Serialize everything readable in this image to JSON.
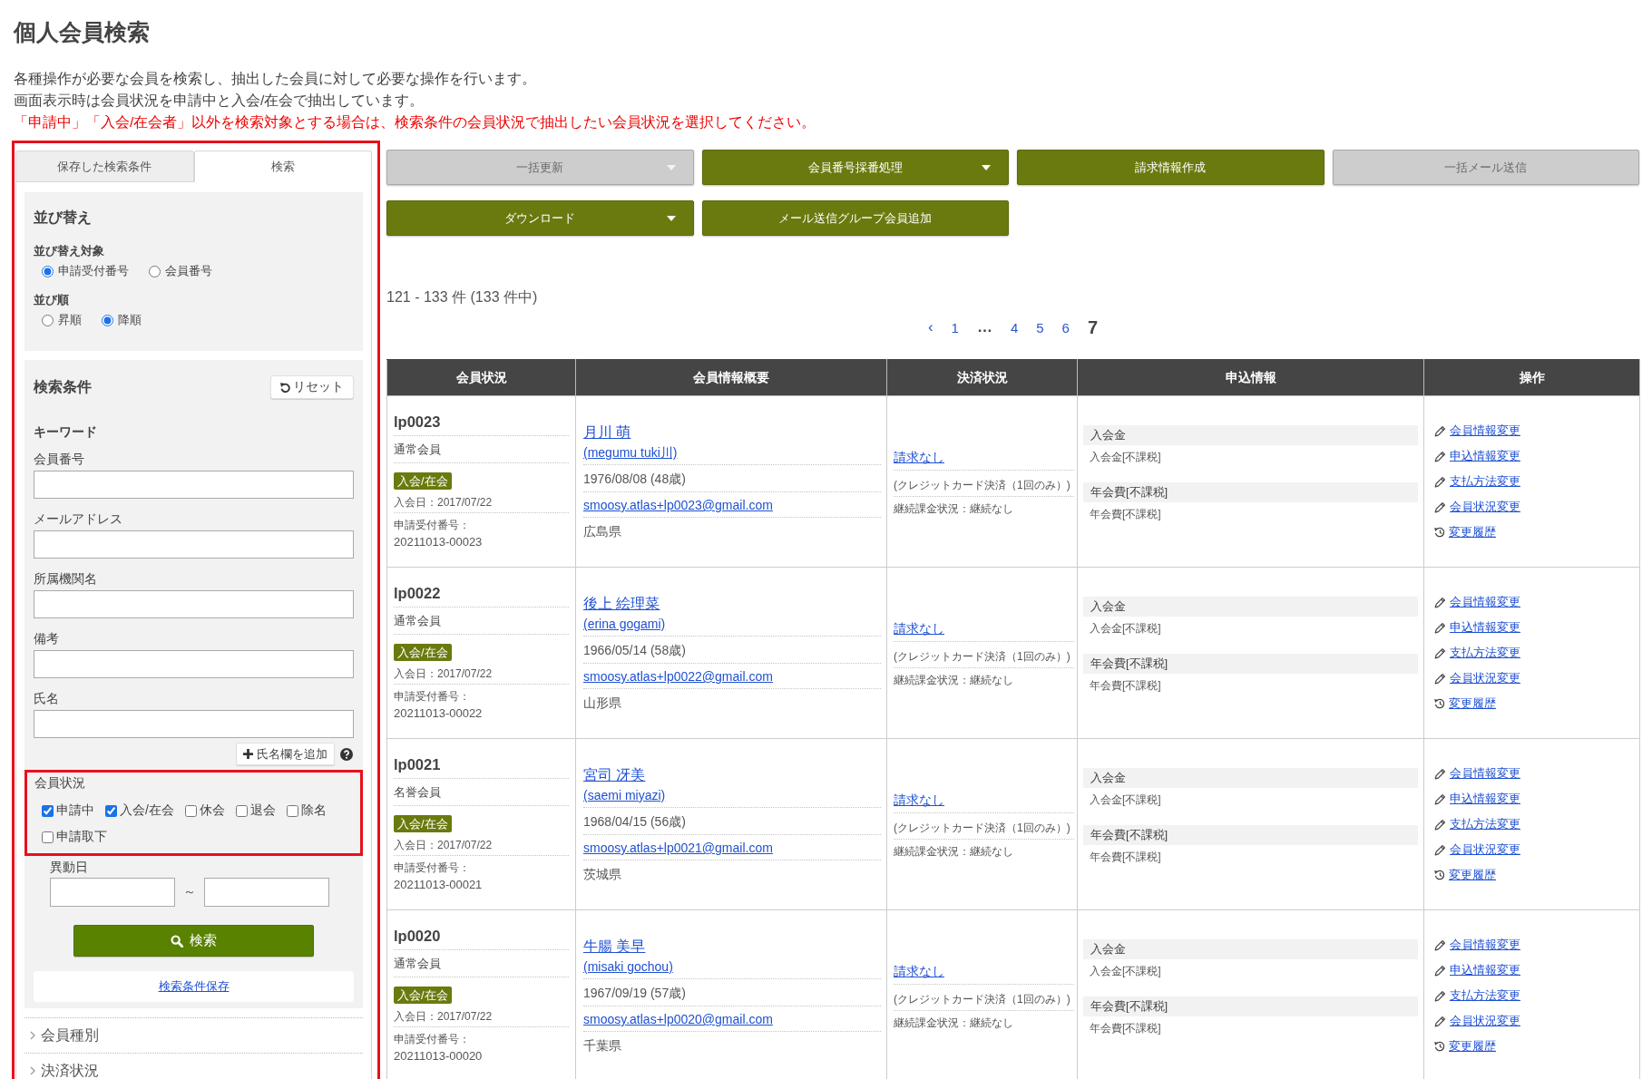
{
  "page": {
    "title": "個人会員検索",
    "description": [
      "各種操作が必要な会員を検索し、抽出した会員に対して必要な操作を行います。",
      "画面表示時は会員状況を申請中と入会/在会で抽出しています。"
    ],
    "notice": "「申請中」「入会/在会者」以外を検索対象とする場合は、検索条件の会員状況で抽出したい会員状況を選択してください。"
  },
  "sidebar": {
    "tabs": [
      {
        "label": "保存した検索条件",
        "selected": false
      },
      {
        "label": "検索",
        "selected": true
      }
    ],
    "sort": {
      "title": "並び替え",
      "target_label": "並び替え対象",
      "target_options": [
        {
          "label": "申請受付番号",
          "selected": true
        },
        {
          "label": "会員番号",
          "selected": false
        }
      ],
      "order_label": "並び順",
      "order_options": [
        {
          "label": "昇順",
          "selected": false
        },
        {
          "label": "降順",
          "selected": true
        }
      ]
    },
    "search": {
      "title": "検索条件",
      "reset_button": "リセット",
      "keyword_label": "キーワード",
      "fields": [
        {
          "label": "会員番号"
        },
        {
          "label": "メールアドレス"
        },
        {
          "label": "所属機関名"
        },
        {
          "label": "備考"
        },
        {
          "label": "氏名"
        }
      ],
      "add_name_button": "氏名欄を追加",
      "status": {
        "label": "会員状況",
        "options": [
          {
            "label": "申請中",
            "checked": true
          },
          {
            "label": "入会/在会",
            "checked": true
          },
          {
            "label": "休会",
            "checked": false
          },
          {
            "label": "退会",
            "checked": false
          },
          {
            "label": "除名",
            "checked": false
          },
          {
            "label": "申請取下",
            "checked": false
          }
        ]
      },
      "date": {
        "label": "異動日",
        "separator": "～"
      },
      "search_button": "検索",
      "save_link": "検索条件保存"
    },
    "sections": [
      {
        "label": "会員種別",
        "expanded": false
      },
      {
        "label": "決済状況",
        "expanded": false
      }
    ]
  },
  "actions": [
    {
      "label": "一括更新",
      "disabled": true,
      "dropdown": true
    },
    {
      "label": "会員番号採番処理",
      "disabled": false,
      "dropdown": true
    },
    {
      "label": "請求情報作成",
      "disabled": false,
      "dropdown": false
    },
    {
      "label": "一括メール送信",
      "disabled": true,
      "dropdown": false
    },
    {
      "label": "ダウンロード",
      "disabled": false,
      "dropdown": true
    },
    {
      "label": "メール送信グループ会員追加",
      "disabled": false,
      "dropdown": false
    }
  ],
  "result_count": "121 - 133 件 (133 件中)",
  "pagination": {
    "prev": "‹",
    "items": [
      {
        "kind": "page",
        "label": "1",
        "selected": false
      },
      {
        "kind": "ellipsis",
        "label": "…"
      },
      {
        "kind": "page",
        "label": "4",
        "selected": false
      },
      {
        "kind": "page",
        "label": "5",
        "selected": false
      },
      {
        "kind": "page",
        "label": "6",
        "selected": false
      },
      {
        "kind": "page",
        "label": "7",
        "selected": true
      }
    ]
  },
  "table": {
    "columns": [
      "会員状況",
      "会員情報概要",
      "決済状況",
      "申込情報",
      "操作"
    ],
    "rows": [
      {
        "member_id": "lp0023",
        "member_type": "通常会員",
        "status_badge": "入会/在会",
        "joined": "入会日：2017/07/22",
        "application_no_label": "申請受付番号：",
        "application_no": "20211013-00023",
        "name": "月川 萌",
        "name_romaji": "(megumu tuki川)",
        "birth": "1976/08/08 (48歳)",
        "email": "smoosy.atlas+lp0023@gmail.com",
        "prefecture": "広島県",
        "billing": "請求なし",
        "payment_method": "(クレジットカード決済（1回のみ）)",
        "continuation": "継続課金状況：継続なし",
        "fees": [
          {
            "title": "入会金",
            "detail": "入会金[不課税]"
          },
          {
            "title": "年会費[不課税]",
            "detail": "年会費[不課税]"
          }
        ],
        "operations": [
          {
            "kind": "edit",
            "label": "会員情報変更"
          },
          {
            "kind": "edit",
            "label": "申込情報変更"
          },
          {
            "kind": "edit",
            "label": "支払方法変更"
          },
          {
            "kind": "edit",
            "label": "会員状況変更"
          },
          {
            "kind": "history",
            "label": "変更履歴"
          }
        ]
      },
      {
        "member_id": "lp0022",
        "member_type": "通常会員",
        "status_badge": "入会/在会",
        "joined": "入会日：2017/07/22",
        "application_no_label": "申請受付番号：",
        "application_no": "20211013-00022",
        "name": "後上 絵理菜",
        "name_romaji": "(erina gogami)",
        "birth": "1966/05/14 (58歳)",
        "email": "smoosy.atlas+lp0022@gmail.com",
        "prefecture": "山形県",
        "billing": "請求なし",
        "payment_method": "(クレジットカード決済（1回のみ）)",
        "continuation": "継続課金状況：継続なし",
        "fees": [
          {
            "title": "入会金",
            "detail": "入会金[不課税]"
          },
          {
            "title": "年会費[不課税]",
            "detail": "年会費[不課税]"
          }
        ],
        "operations": [
          {
            "kind": "edit",
            "label": "会員情報変更"
          },
          {
            "kind": "edit",
            "label": "申込情報変更"
          },
          {
            "kind": "edit",
            "label": "支払方法変更"
          },
          {
            "kind": "edit",
            "label": "会員状況変更"
          },
          {
            "kind": "history",
            "label": "変更履歴"
          }
        ]
      },
      {
        "member_id": "lp0021",
        "member_type": "名誉会員",
        "status_badge": "入会/在会",
        "joined": "入会日：2017/07/22",
        "application_no_label": "申請受付番号：",
        "application_no": "20211013-00021",
        "name": "宮司 冴美",
        "name_romaji": "(saemi miyazi)",
        "birth": "1968/04/15 (56歳)",
        "email": "smoosy.atlas+lp0021@gmail.com",
        "prefecture": "茨城県",
        "billing": "請求なし",
        "payment_method": "(クレジットカード決済（1回のみ）)",
        "continuation": "継続課金状況：継続なし",
        "fees": [
          {
            "title": "入会金",
            "detail": "入会金[不課税]"
          },
          {
            "title": "年会費[不課税]",
            "detail": "年会費[不課税]"
          }
        ],
        "operations": [
          {
            "kind": "edit",
            "label": "会員情報変更"
          },
          {
            "kind": "edit",
            "label": "申込情報変更"
          },
          {
            "kind": "edit",
            "label": "支払方法変更"
          },
          {
            "kind": "edit",
            "label": "会員状況変更"
          },
          {
            "kind": "history",
            "label": "変更履歴"
          }
        ]
      },
      {
        "member_id": "lp0020",
        "member_type": "通常会員",
        "status_badge": "入会/在会",
        "joined": "入会日：2017/07/22",
        "application_no_label": "申請受付番号：",
        "application_no": "20211013-00020",
        "name": "牛腸 美早",
        "name_romaji": "(misaki gochou)",
        "birth": "1967/09/19 (57歳)",
        "email": "smoosy.atlas+lp0020@gmail.com",
        "prefecture": "千葉県",
        "billing": "請求なし",
        "payment_method": "(クレジットカード決済（1回のみ）)",
        "continuation": "継続課金状況：継続なし",
        "fees": [
          {
            "title": "入会金",
            "detail": "入会金[不課税]"
          },
          {
            "title": "年会費[不課税]",
            "detail": "年会費[不課税]"
          }
        ],
        "operations": [
          {
            "kind": "edit",
            "label": "会員情報変更"
          },
          {
            "kind": "edit",
            "label": "申込情報変更"
          },
          {
            "kind": "edit",
            "label": "支払方法変更"
          },
          {
            "kind": "edit",
            "label": "会員状況変更"
          },
          {
            "kind": "history",
            "label": "変更履歴"
          }
        ]
      }
    ]
  }
}
